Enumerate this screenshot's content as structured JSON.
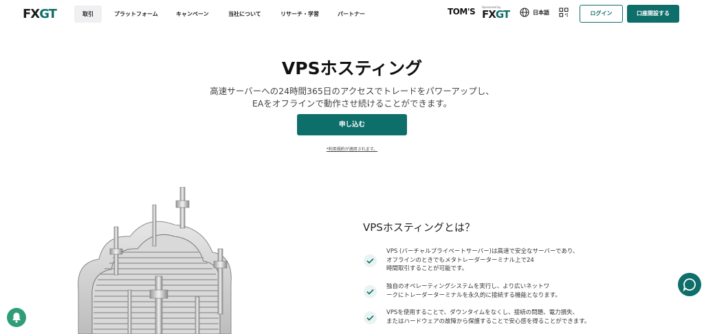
{
  "brand": {
    "logo_fx": "FX",
    "logo_gt": "GT"
  },
  "nav": {
    "items": [
      {
        "label": "取引",
        "active": true
      },
      {
        "label": "プラットフォーム",
        "active": false
      },
      {
        "label": "キャンペーン",
        "active": false
      },
      {
        "label": "当社について",
        "active": false
      },
      {
        "label": "リサーチ・学習",
        "active": false
      },
      {
        "label": "パートナー",
        "active": false
      }
    ],
    "partner_logo": "TOM'S",
    "sponsored_text": "Sponsored by",
    "partner_fxgt_fx": "FX",
    "partner_fxgt_gt": "GT",
    "language": "日本語",
    "login_label": "ログイン",
    "open_account_label": "口座開設する"
  },
  "hero": {
    "title": "VPSホスティング",
    "subtitle_line1": "高速サーバーへの24時間365日のアクセスでトレードをパワーアップし、",
    "subtitle_line2": "EAをオフラインで動作させ続けることができます。",
    "cta_label": "申し込む",
    "terms_text": "*利用規約が適用されます。"
  },
  "about": {
    "title": "VPSホスティングとは？",
    "features": [
      {
        "lines": [
          "VPS (バーチャルプライベートサーバー)は高速で安全なサーバーであり、",
          "オフラインのときでもメタトレーダーターミナル上で24",
          "時間取引することが可能です。"
        ]
      },
      {
        "lines": [
          "独自のオペレーティングシステムを実行し、より広いネットワ",
          "ークにトレーダーターミナルを永久的に接続する機能となります。"
        ]
      },
      {
        "lines": [
          "VPSを使用することで、ダウンタイムをなくし、接続の問題、電力損失、",
          "またはハードウェアの故障から保護することで安心感を得ることができます。"
        ]
      }
    ]
  },
  "colors": {
    "accent": "#0e6e6a",
    "notification": "#2f9e78",
    "nav_active_bg": "#f0f0f2"
  },
  "icons": [
    "globe-icon",
    "qr-code-icon",
    "check-icon",
    "chat-icon",
    "bell-icon"
  ]
}
